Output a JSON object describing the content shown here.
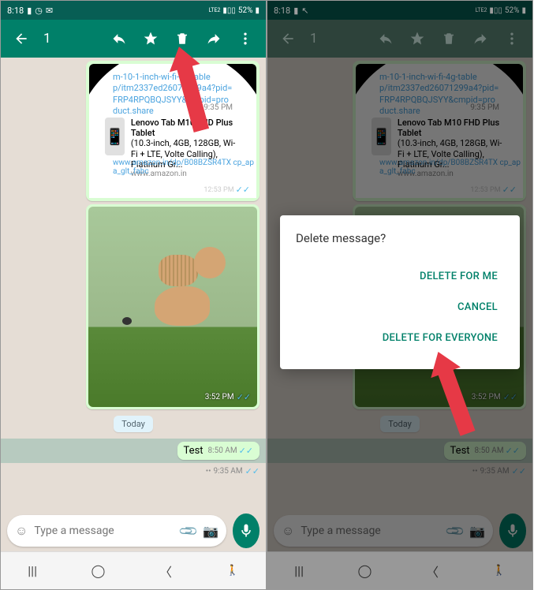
{
  "status": {
    "time": "8:18",
    "battery": "52%",
    "network": "LTE2"
  },
  "topbar": {
    "count": "1"
  },
  "link_preview": {
    "url_line1": "m-10-1-inch-wi-fi-4g-table",
    "url_line2": "p/itm2337ed26071299a4?pid=",
    "url_line3": "FRP4RPQBQJSYY&cmpid=product.share",
    "time1": "9:35 PM",
    "product_title": "Lenovo Tab M10 FHD Plus Tablet",
    "product_desc": "(10.3-inch, 4GB, 128GB, Wi-Fi + LTE, Volte Calling), Platinum Gr...",
    "product_domain": "www.amazon.in",
    "amz_url": "www.amazon.in/dp/B08BZSR4TX cp_apa_glt_fabc",
    "time2": "12:53 PM"
  },
  "image_msg": {
    "time": "3:52 PM"
  },
  "date_chip": "Today",
  "test_msg": {
    "text": "Test",
    "time": "8:50 AM"
  },
  "small_msg": {
    "time": "9:35 AM"
  },
  "input": {
    "placeholder": "Type a message"
  },
  "dialog": {
    "title": "Delete message?",
    "delete_me": "DELETE FOR ME",
    "cancel": "CANCEL",
    "delete_all": "DELETE FOR EVERYONE"
  }
}
